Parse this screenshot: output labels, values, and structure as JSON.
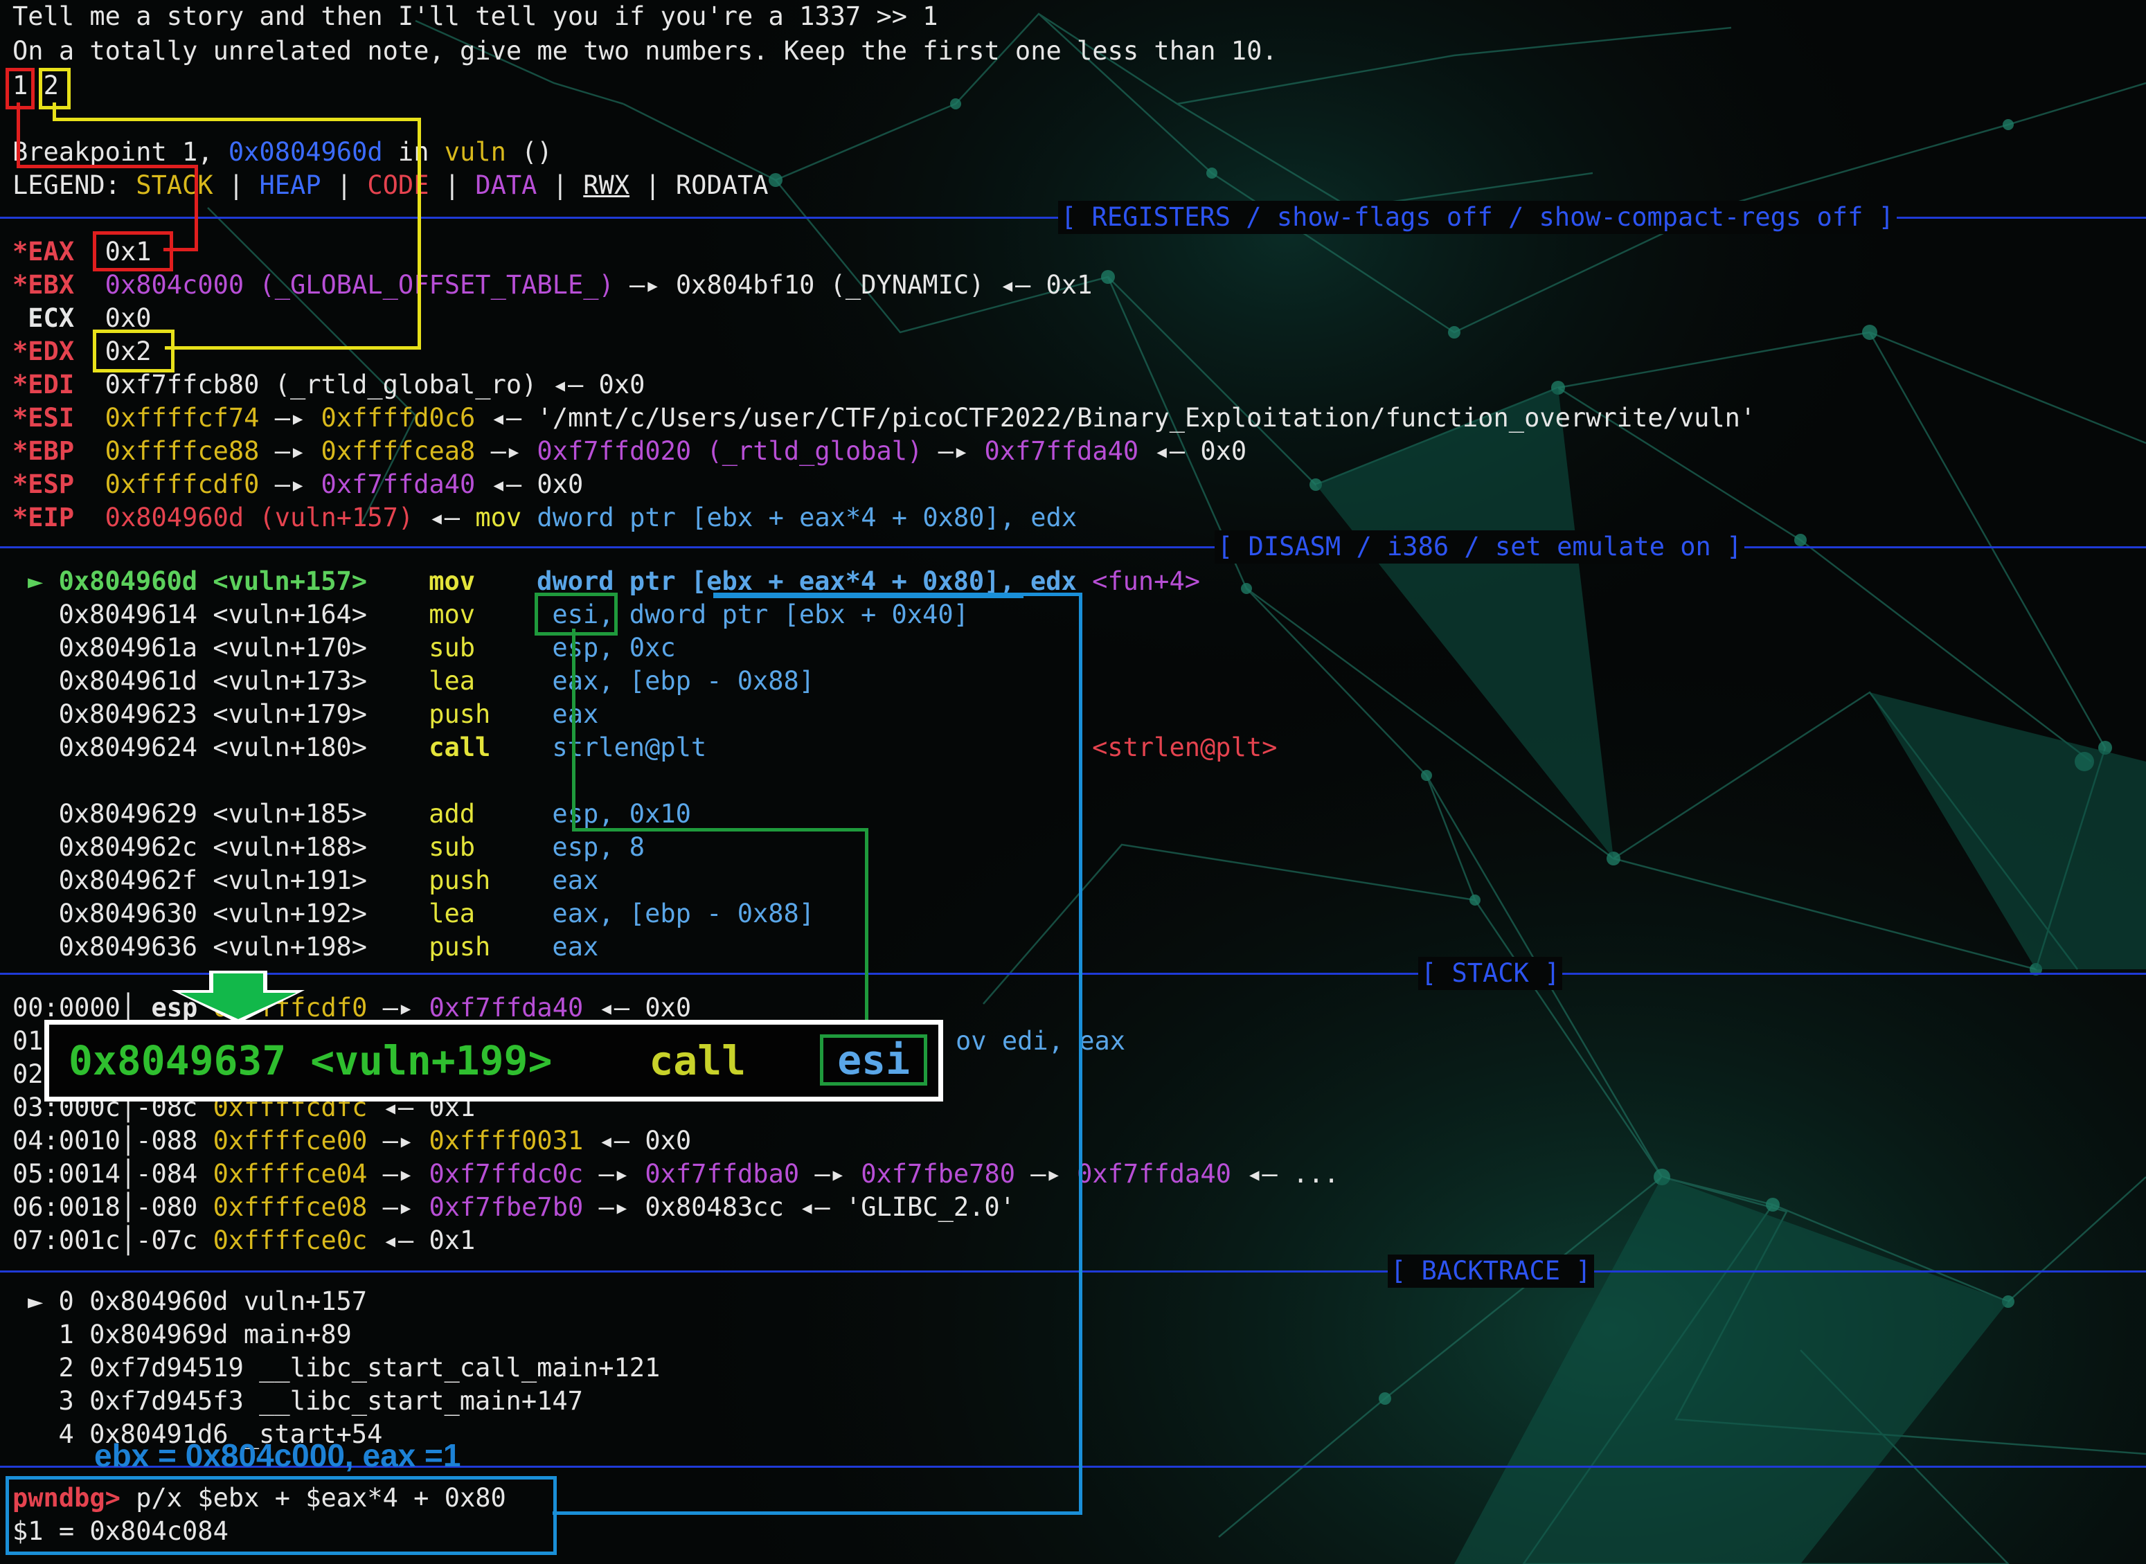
{
  "output": {
    "line1": "Tell me a story and then I'll tell you if you're a 1337 >> 1",
    "line2": "On a totally unrelated note, give me two numbers. Keep the first one less than 10.",
    "num1": "1",
    "num2": "2"
  },
  "breakpoint": {
    "prefix": "Breakpoint 1, ",
    "addr": "0x0804960d",
    "in": " in ",
    "func": "vuln",
    "suffix": " ()"
  },
  "legend": {
    "label": "LEGEND: ",
    "stack": "STACK",
    "heap": "HEAP",
    "code": "CODE",
    "data": "DATA",
    "rwx": "RWX",
    "rodata": "RODATA",
    "pipe": " | "
  },
  "sections": {
    "registers": "[ REGISTERS / show-flags off / show-compact-regs off ]",
    "disasm": "[ DISASM / i386 / set emulate on ]",
    "stack": "[ STACK ]",
    "backtrace": "[ BACKTRACE ]"
  },
  "registers": {
    "eax": {
      "name": "*EAX",
      "val": "0x1"
    },
    "ebx": {
      "name": "*EBX",
      "val": "0x804c000 (_GLOBAL_OFFSET_TABLE_)",
      "arrow": " —▸ ",
      "t1": "0x804bf10 (_DYNAMIC)",
      "larrow": " ◂— ",
      "t2": "0x1"
    },
    "ecx": {
      "name": " ECX",
      "val": "0x0"
    },
    "edx": {
      "name": "*EDX",
      "val": "0x2"
    },
    "edi": {
      "name": "*EDI",
      "val": "0xf7ffcb80 (_rtld_global_ro)",
      "larrow": " ◂— ",
      "t1": "0x0"
    },
    "esi": {
      "name": "*ESI",
      "val": "0xffffcf74",
      "arrow": " —▸ ",
      "t1": "0xffffd0c6",
      "larrow": " ◂— ",
      "t2": "'/mnt/c/Users/user/CTF/picoCTF2022/Binary_Exploitation/function_overwrite/vuln'"
    },
    "ebp": {
      "name": "*EBP",
      "val": "0xffffce88",
      "arrow": " —▸ ",
      "t1": "0xffffcea8",
      "t2": "0xf7ffd020 (_rtld_global)",
      "t3": "0xf7ffda40",
      "larrow": " ◂— ",
      "t4": "0x0"
    },
    "esp": {
      "name": "*ESP",
      "val": "0xffffcdf0",
      "arrow": " —▸ ",
      "t1": "0xf7ffda40",
      "larrow": " ◂— ",
      "t2": "0x0"
    },
    "eip": {
      "name": "*EIP",
      "val": "0x804960d (vuln+157)",
      "larrow": " ◂— ",
      "t1": "mov",
      "t2": "dword ptr",
      "t3": "[ebx + eax*4 + 0x80]",
      "t4": ", edx"
    }
  },
  "disasm": [
    {
      "marker": "►",
      "addr": "0x804960d <vuln+157>",
      "op": "mov",
      "args": "dword ptr [ebx + eax*4 + 0x80], edx",
      "extra": "<fun+4>"
    },
    {
      "marker": " ",
      "addr": "0x8049614 <vuln+164>",
      "op": "mov",
      "args": "esi, dword ptr [ebx + 0x40]",
      "extra": ""
    },
    {
      "marker": " ",
      "addr": "0x804961a <vuln+170>",
      "op": "sub",
      "args": "esp, 0xc",
      "extra": ""
    },
    {
      "marker": " ",
      "addr": "0x804961d <vuln+173>",
      "op": "lea",
      "args": "eax, [ebp - 0x88]",
      "extra": ""
    },
    {
      "marker": " ",
      "addr": "0x8049623 <vuln+179>",
      "op": "push",
      "args": "eax",
      "extra": ""
    },
    {
      "marker": " ",
      "addr": "0x8049624 <vuln+180>",
      "op": "call",
      "args": "strlen@plt",
      "extra": "<strlen@plt>"
    },
    {
      "marker": " ",
      "addr": "0x8049629 <vuln+185>",
      "op": "add",
      "args": "esp, 0x10",
      "extra": ""
    },
    {
      "marker": " ",
      "addr": "0x804962c <vuln+188>",
      "op": "sub",
      "args": "esp, 8",
      "extra": ""
    },
    {
      "marker": " ",
      "addr": "0x804962f <vuln+191>",
      "op": "push",
      "args": "eax",
      "extra": ""
    },
    {
      "marker": " ",
      "addr": "0x8049630 <vuln+192>",
      "op": "lea",
      "args": "eax, [ebp - 0x88]",
      "extra": ""
    },
    {
      "marker": " ",
      "addr": "0x8049636 <vuln+198>",
      "op": "push",
      "args": "eax",
      "extra": ""
    }
  ],
  "stack": [
    {
      "idx": "00:0000",
      "off": "esp",
      "addr": "0xffffcdf0",
      "arrow": " —▸ ",
      "t1": "0xf7ffda40",
      "larrow": " ◂— ",
      "t2": "0x0"
    },
    {
      "idx": "01",
      "tail": "ov edi, eax"
    },
    {
      "idx": "02"
    },
    {
      "idx": "03:000c",
      "off": "-08c",
      "addr": "0xffffcdfc",
      "larrow": " ◂— ",
      "t1": "0x1"
    },
    {
      "idx": "04:0010",
      "off": "-088",
      "addr": "0xffffce00",
      "arrow": " —▸ ",
      "t1": "0xffff0031",
      "larrow": " ◂— ",
      "t2": "0x0"
    },
    {
      "idx": "05:0014",
      "off": "-084",
      "addr": "0xffffce04",
      "arrow": " —▸ ",
      "t1": "0xf7ffdc0c",
      "t2": "0xf7ffdba0",
      "t3": "0xf7fbe780",
      "t4": "0xf7ffda40",
      "larrow": " ◂— ",
      "t5": "..."
    },
    {
      "idx": "06:0018",
      "off": "-080",
      "addr": "0xffffce08",
      "arrow": " —▸ ",
      "t1": "0xf7fbe7b0",
      "t2": "0x80483cc",
      "larrow": " ◂— ",
      "t3": "'GLIBC_2.0'"
    },
    {
      "idx": "07:001c",
      "off": "-07c",
      "addr": "0xffffce0c",
      "larrow": " ◂— ",
      "t1": "0x1"
    }
  ],
  "backtrace": [
    {
      "text": "► 0 0x804960d vuln+157"
    },
    {
      "text": "  1 0x804969d main+89"
    },
    {
      "text": "  2 0xf7d94519 __libc_start_call_main+121"
    },
    {
      "text": "  3 0xf7d945f3 __libc_start_main+147"
    },
    {
      "text": "  4 0x80491d6 _start+54"
    }
  ],
  "callout": {
    "addr": "0x8049637 <vuln+199>",
    "op": "call",
    "reg": "esi"
  },
  "note": "ebx = 0x804c000, eax =1",
  "command": {
    "prompt": "pwndbg>",
    "input": " p/x $ebx + $eax*4 + 0x80",
    "result": "$1 = 0x804c084"
  }
}
